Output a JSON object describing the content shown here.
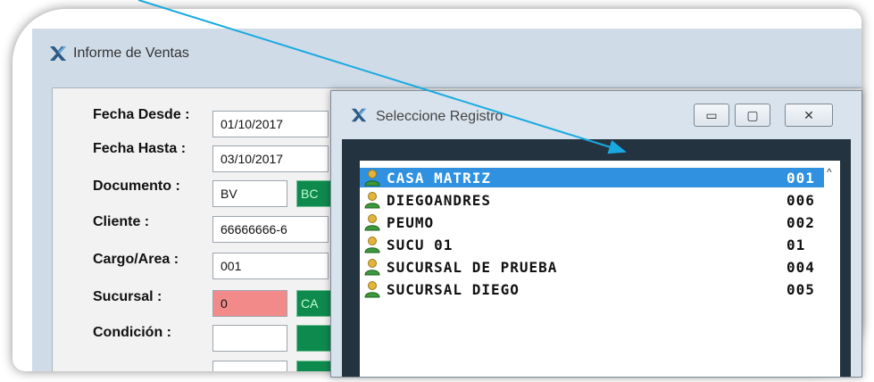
{
  "main_window": {
    "title": "Informe de Ventas"
  },
  "form": {
    "fecha_desde": {
      "label": "Fecha Desde :",
      "value": "01/10/2017"
    },
    "fecha_hasta": {
      "label": "Fecha Hasta :",
      "value": "03/10/2017"
    },
    "documento": {
      "label": "Documento :",
      "value": "BV",
      "code": "BC"
    },
    "cliente": {
      "label": "Cliente :",
      "value": "66666666-6"
    },
    "cargo_area": {
      "label": "Cargo/Area :",
      "value": "001"
    },
    "sucursal": {
      "label": "Sucursal :",
      "value": "0",
      "code": "CA"
    },
    "condicion": {
      "label": "Condición :",
      "value": ""
    }
  },
  "dialog": {
    "title": "Seleccione Registro",
    "buttons": {
      "minimize": "▭",
      "maximize": "▢",
      "close": "✕"
    },
    "records": [
      {
        "name": "CASA MATRIZ",
        "code": "001",
        "selected": true
      },
      {
        "name": "DIEGOANDRES",
        "code": "006",
        "selected": false
      },
      {
        "name": "PEUMO",
        "code": "002",
        "selected": false
      },
      {
        "name": "SUCU 01",
        "code": "01",
        "selected": false
      },
      {
        "name": "SUCURSAL DE PRUEBA",
        "code": "004",
        "selected": false
      },
      {
        "name": "SUCURSAL DIEGO",
        "code": "005",
        "selected": false
      }
    ],
    "scroll_up": "^"
  },
  "annotation": {
    "arrow_color": "#19a9e0"
  },
  "colors": {
    "selection": "#2f91e0",
    "green_button": "#0f8a4f",
    "red_input": "#f28a8a"
  }
}
